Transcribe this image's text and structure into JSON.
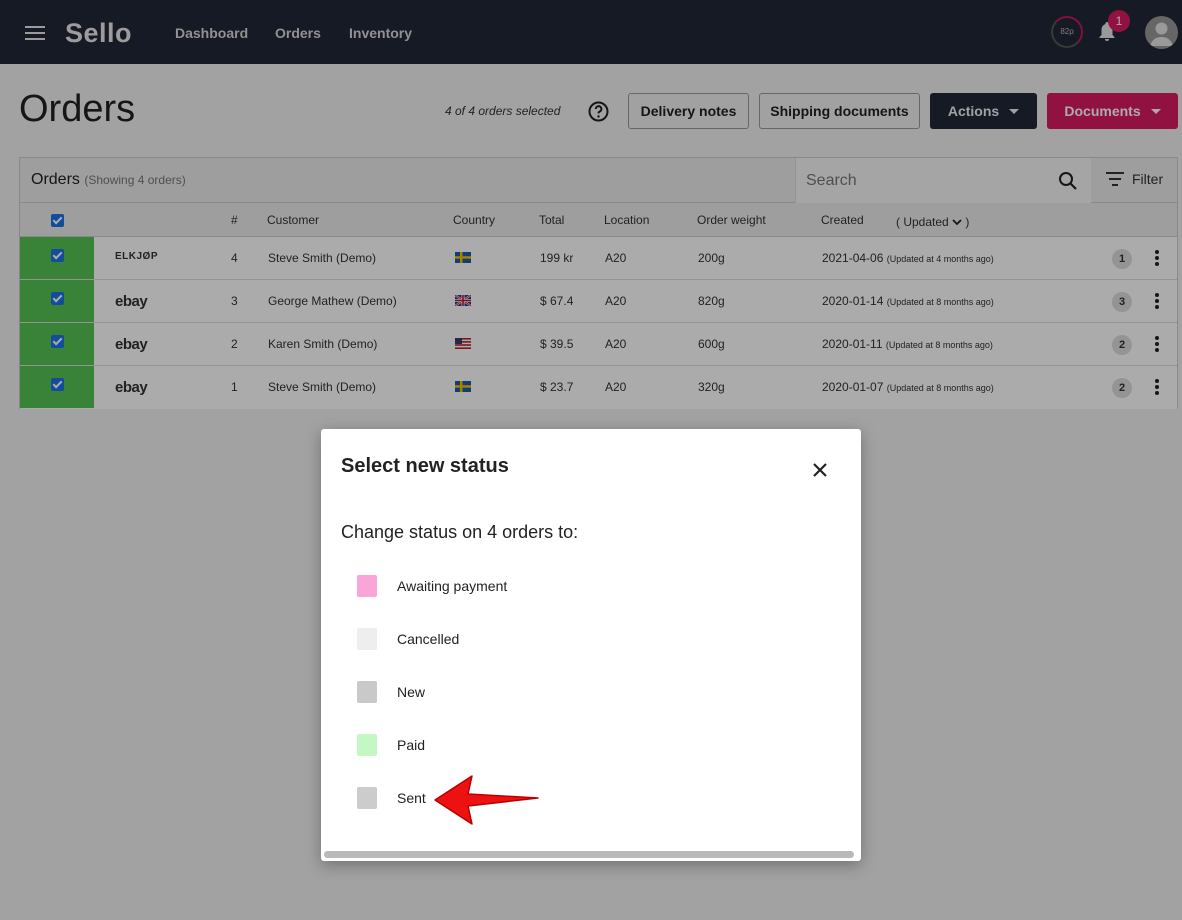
{
  "topbar": {
    "logo": "Sello",
    "nav": [
      "Dashboard",
      "Orders",
      "Inventory"
    ],
    "points": "82p",
    "notifications": "1"
  },
  "header": {
    "title": "Orders",
    "selected": "4 of 4 orders selected",
    "buttons": {
      "delivery": "Delivery notes",
      "shipping": "Shipping documents",
      "actions": "Actions",
      "documents": "Documents"
    }
  },
  "orders_card": {
    "title": "Orders",
    "subtitle": "(Showing 4 orders)",
    "search_placeholder": "Search",
    "filter": "Filter",
    "columns": {
      "num": "#",
      "customer": "Customer",
      "country": "Country",
      "total": "Total",
      "location": "Location",
      "weight": "Order weight",
      "created": "Created",
      "sort": "( Updated",
      "sort_close": ")"
    },
    "rows": [
      {
        "channel": "ELKJØP",
        "num": "4",
        "customer": "Steve Smith (Demo)",
        "country": "SE",
        "total": "199 kr",
        "location": "A20",
        "weight": "200g",
        "created": "2021-04-06",
        "updated": "(Updated at 4 months ago)",
        "count": "1"
      },
      {
        "channel": "ebay",
        "num": "3",
        "customer": "George Mathew (Demo)",
        "country": "GB",
        "total": "$ 67.4",
        "location": "A20",
        "weight": "820g",
        "created": "2020-01-14",
        "updated": "(Updated at 8 months ago)",
        "count": "3"
      },
      {
        "channel": "ebay",
        "num": "2",
        "customer": "Karen Smith (Demo)",
        "country": "US",
        "total": "$ 39.5",
        "location": "A20",
        "weight": "600g",
        "created": "2020-01-11",
        "updated": "(Updated at 8 months ago)",
        "count": "2"
      },
      {
        "channel": "ebay",
        "num": "1",
        "customer": "Steve Smith (Demo)",
        "country": "SE",
        "total": "$ 23.7",
        "location": "A20",
        "weight": "320g",
        "created": "2020-01-07",
        "updated": "(Updated at 8 months ago)",
        "count": "2"
      }
    ]
  },
  "modal": {
    "title": "Select new status",
    "subtitle": "Change status on 4 orders to:",
    "options": [
      {
        "label": "Awaiting payment",
        "color": "#f9a5d8"
      },
      {
        "label": "Cancelled",
        "color": "#eeeeee"
      },
      {
        "label": "New",
        "color": "#c9c9c9"
      },
      {
        "label": "Paid",
        "color": "#c5f7c5"
      },
      {
        "label": "Sent",
        "color": "#cccccc"
      }
    ]
  },
  "colors": {
    "topbar": "#212838",
    "accent": "#d81b60",
    "selected_row": "#55c455"
  }
}
